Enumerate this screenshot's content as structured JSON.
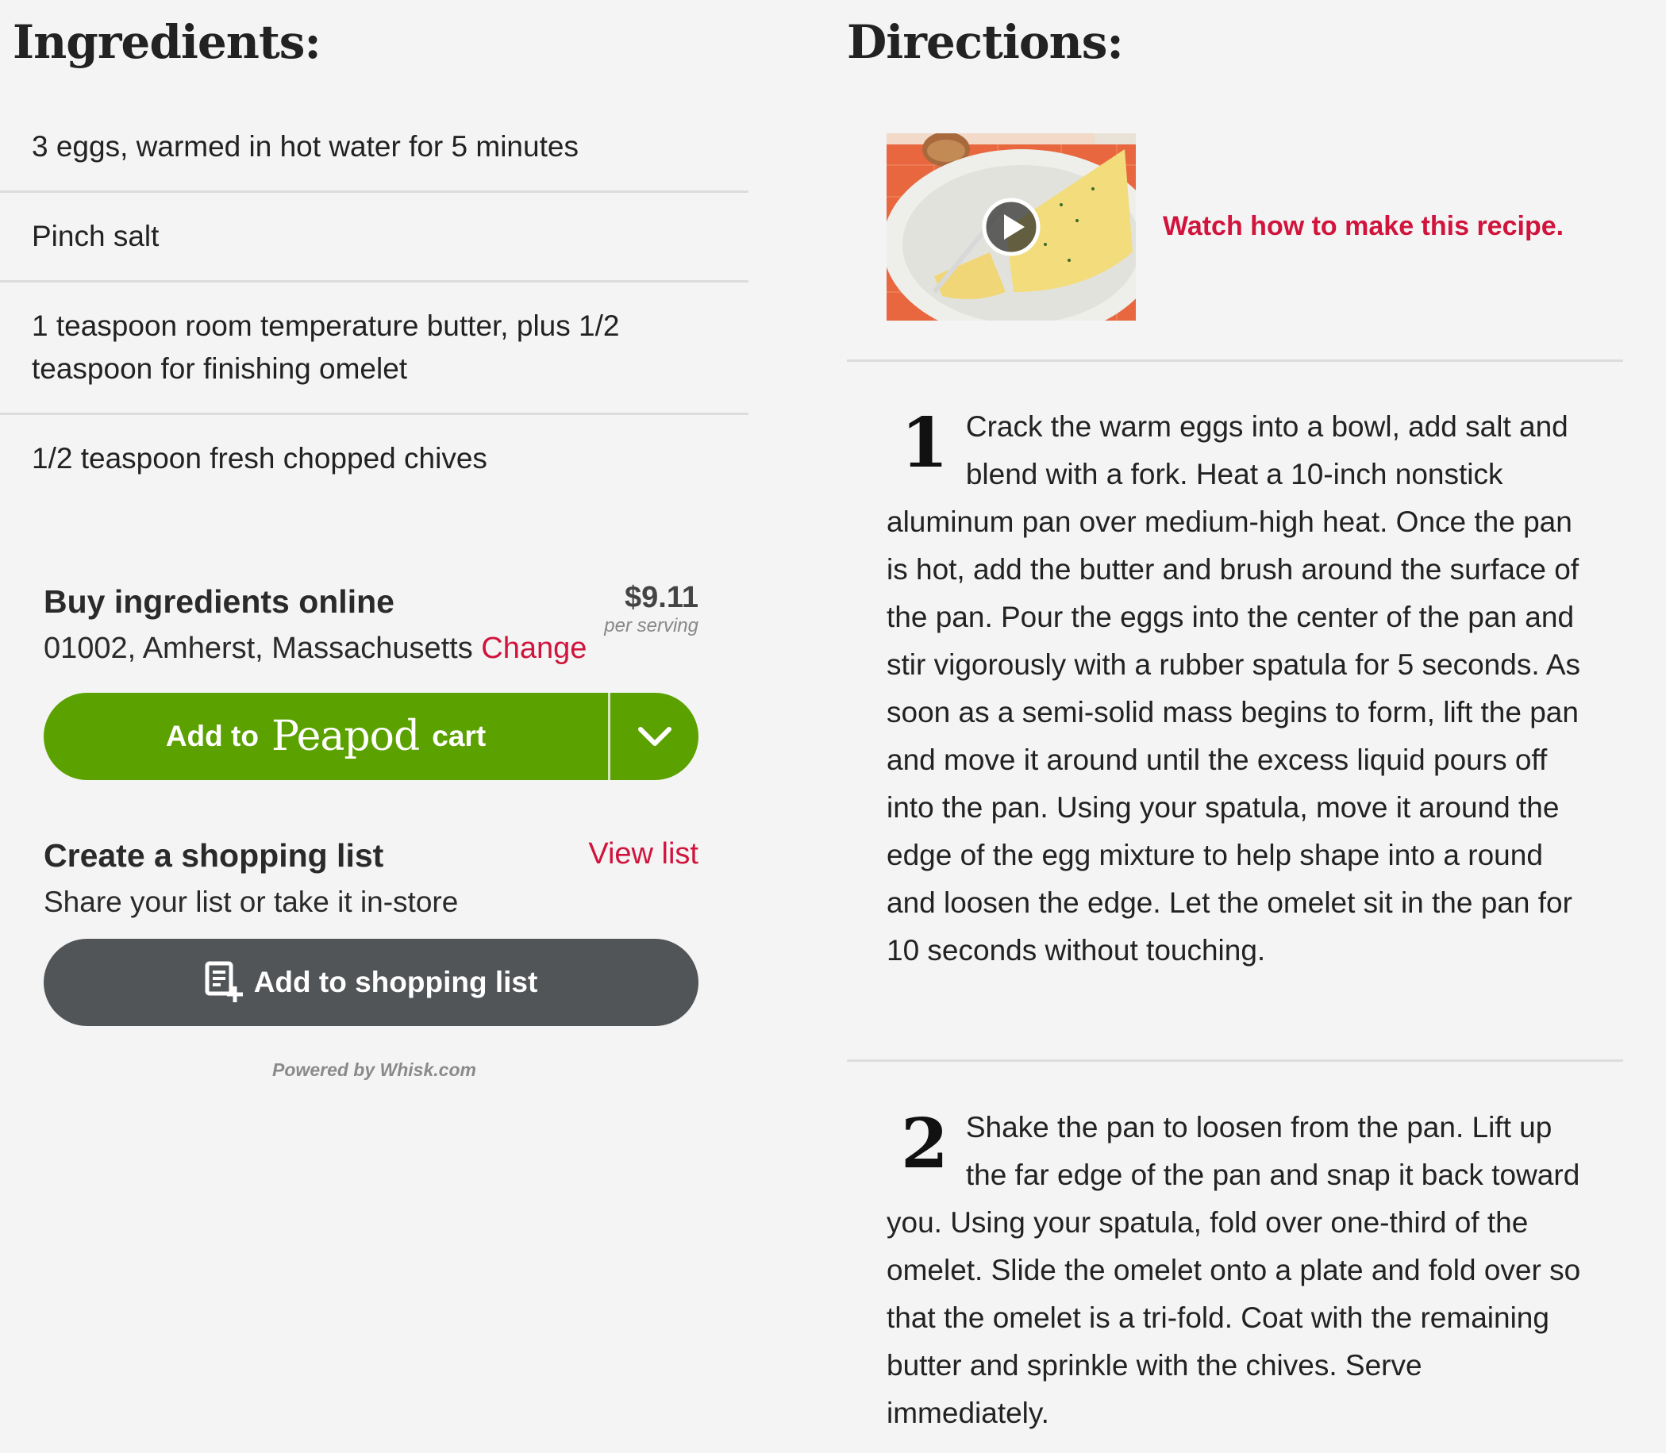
{
  "ingredients": {
    "heading": "Ingredients:",
    "items": [
      "3 eggs, warmed in hot water for 5 minutes",
      "Pinch salt",
      "1 teaspoon room temperature butter, plus 1/2 teaspoon for finishing omelet",
      "1/2 teaspoon fresh chopped chives"
    ]
  },
  "buy": {
    "title": "Buy ingredients online",
    "price": "$9.11",
    "price_sub": "per serving",
    "location": "01002, Amherst, Massachusetts",
    "change_label": "Change",
    "cart_prefix": "Add to",
    "cart_brand": "Peapod",
    "cart_suffix": "cart"
  },
  "shopping": {
    "title": "Create a shopping list",
    "view_list": "View list",
    "subtitle": "Share your list or take it in-store",
    "button_label": "Add to shopping list"
  },
  "powered_by": "Powered by Whisk.com",
  "directions": {
    "heading": "Directions:",
    "video_link": "Watch how to make this recipe.",
    "steps": [
      {
        "num": "1",
        "text": "Crack the warm eggs into a bowl, add salt and blend with a fork. Heat a 10-inch nonstick aluminum pan over medium-high heat. Once the pan is hot, add the butter and brush around the surface of the pan. Pour the eggs into the center of the pan and stir vigorously with a rubber spatula for 5 seconds. As soon as a semi-solid mass begins to form, lift the pan and move it around until the excess liquid pours off into the pan. Using your spatula, move it around the edge of the egg mixture to help shape into a round and loosen the edge. Let the omelet sit in the pan for 10 seconds without touching."
      },
      {
        "num": "2",
        "text": "Shake the pan to loosen from the pan. Lift up the far edge of the pan and snap it back toward you. Using your spatula, fold over one-third of the omelet. Slide the omelet onto a plate and fold over so that the omelet is a tri-fold. Coat with the remaining butter and sprinkle with the chives. Serve immediately."
      }
    ]
  },
  "colors": {
    "accent_red": "#d0143c",
    "peapod_green": "#5ba200",
    "shopping_gray": "#525557"
  }
}
